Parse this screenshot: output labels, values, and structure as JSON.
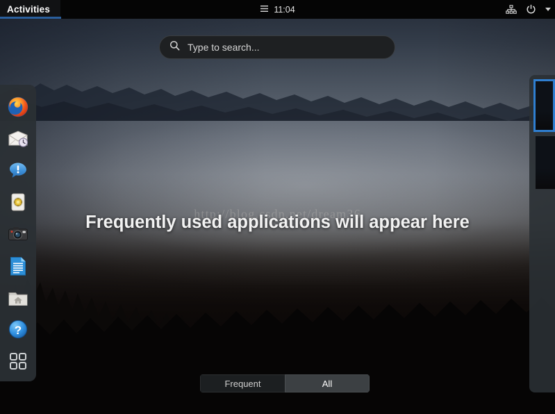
{
  "topbar": {
    "activities_label": "Activities",
    "menu_icon": "hamburger-menu-icon",
    "clock": "11:04",
    "network_icon": "wired-network-icon",
    "power_icon": "power-icon",
    "dropdown_icon": "chevron-down-icon",
    "underline_color": "#2a5f9e",
    "background_color": "#050505"
  },
  "search": {
    "icon": "search-icon",
    "placeholder": "Type to search...",
    "value": ""
  },
  "dash": {
    "background_color": "#2a3034",
    "items": [
      {
        "label": "Firefox",
        "icon": "firefox-icon"
      },
      {
        "label": "Evolution Mail",
        "icon": "mail-icon"
      },
      {
        "label": "Empathy Chat",
        "icon": "chat-bubble-icon"
      },
      {
        "label": "Software Updates",
        "icon": "software-updates-icon"
      },
      {
        "label": "Cheese Webcam",
        "icon": "camera-icon"
      },
      {
        "label": "Document Writer",
        "icon": "document-icon"
      },
      {
        "label": "Files Home Folder",
        "icon": "folder-home-icon"
      },
      {
        "label": "Help",
        "icon": "help-icon"
      }
    ],
    "app_grid": {
      "label": "Show Applications",
      "icon": "app-grid-icon"
    }
  },
  "overview": {
    "empty_message": "Frequently used applications will appear here",
    "watermark": "http://blog.csdn.net/dream36"
  },
  "view_selector": {
    "tabs": [
      {
        "label": "Frequent",
        "active": false
      },
      {
        "label": "All",
        "active": true
      }
    ]
  },
  "workspaces": {
    "selected_border_color": "#2f7fd1",
    "items": [
      {
        "label": "Workspace 1",
        "selected": true
      },
      {
        "label": "Workspace 2",
        "selected": false
      }
    ]
  }
}
